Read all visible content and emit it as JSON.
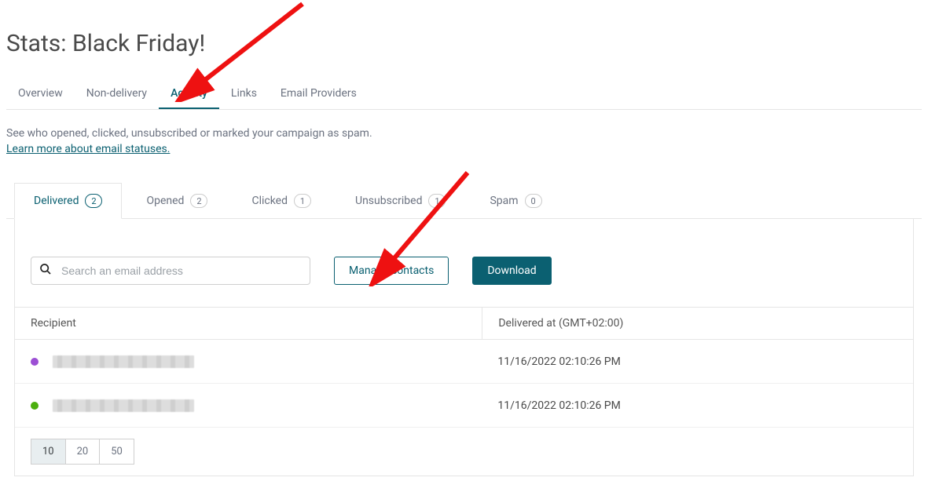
{
  "header": {
    "title": "Stats: Black Friday!"
  },
  "nav_tabs": {
    "overview": "Overview",
    "non_delivery": "Non-delivery",
    "activity": "Activity",
    "links": "Links",
    "email_providers": "Email Providers"
  },
  "description": "See who opened, clicked, unsubscribed or marked your campaign as spam.",
  "learn_more": "Learn more about email statuses.",
  "filter_tabs": {
    "delivered": {
      "label": "Delivered",
      "count": "2"
    },
    "opened": {
      "label": "Opened",
      "count": "2"
    },
    "clicked": {
      "label": "Clicked",
      "count": "1"
    },
    "unsubscribed": {
      "label": "Unsubscribed",
      "count": "1"
    },
    "spam": {
      "label": "Spam",
      "count": "0"
    }
  },
  "toolbar": {
    "search_placeholder": "Search an email address",
    "manage_label": "Manage contacts",
    "download_label": "Download"
  },
  "table": {
    "columns": {
      "recipient": "Recipient",
      "delivered_at": "Delivered at (GMT+02:00)"
    },
    "rows": [
      {
        "status_color": "purple",
        "delivered_at": "11/16/2022 02:10:26 PM"
      },
      {
        "status_color": "green",
        "delivered_at": "11/16/2022 02:10:26 PM"
      }
    ]
  },
  "pagination": {
    "options": [
      "10",
      "20",
      "50"
    ],
    "selected": "10"
  }
}
